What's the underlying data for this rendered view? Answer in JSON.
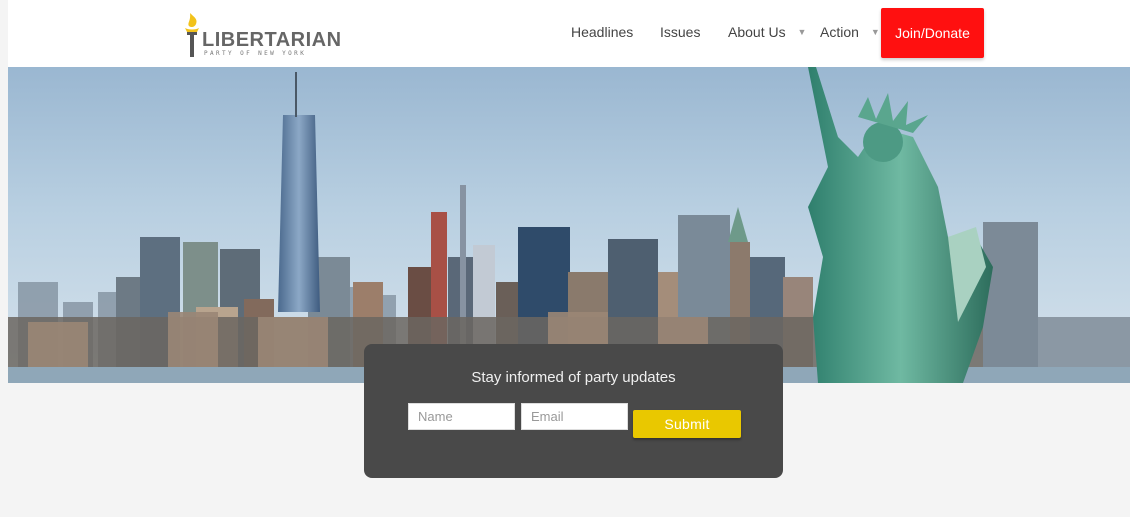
{
  "brand": {
    "name": "LIBERTARIAN",
    "tagline": "PARTY OF NEW YORK",
    "torch_color": "#f2c21a"
  },
  "nav": {
    "items": [
      {
        "label": "Headlines",
        "has_dropdown": false
      },
      {
        "label": "Issues",
        "has_dropdown": false
      },
      {
        "label": "About Us",
        "has_dropdown": true
      },
      {
        "label": "Action",
        "has_dropdown": true
      }
    ],
    "cta_label": "Join/Donate",
    "cta_color": "#ff1010"
  },
  "hero": {
    "scene": "nyc-skyline-statue-of-liberty"
  },
  "signup": {
    "title": "Stay informed of party updates",
    "name_placeholder": "Name",
    "email_placeholder": "Email",
    "name_value": "",
    "email_value": "",
    "submit_label": "Submit",
    "submit_color": "#e9c800",
    "panel_color": "#494949"
  },
  "icons": [
    "torch-logo-icon",
    "chevron-down-icon"
  ]
}
